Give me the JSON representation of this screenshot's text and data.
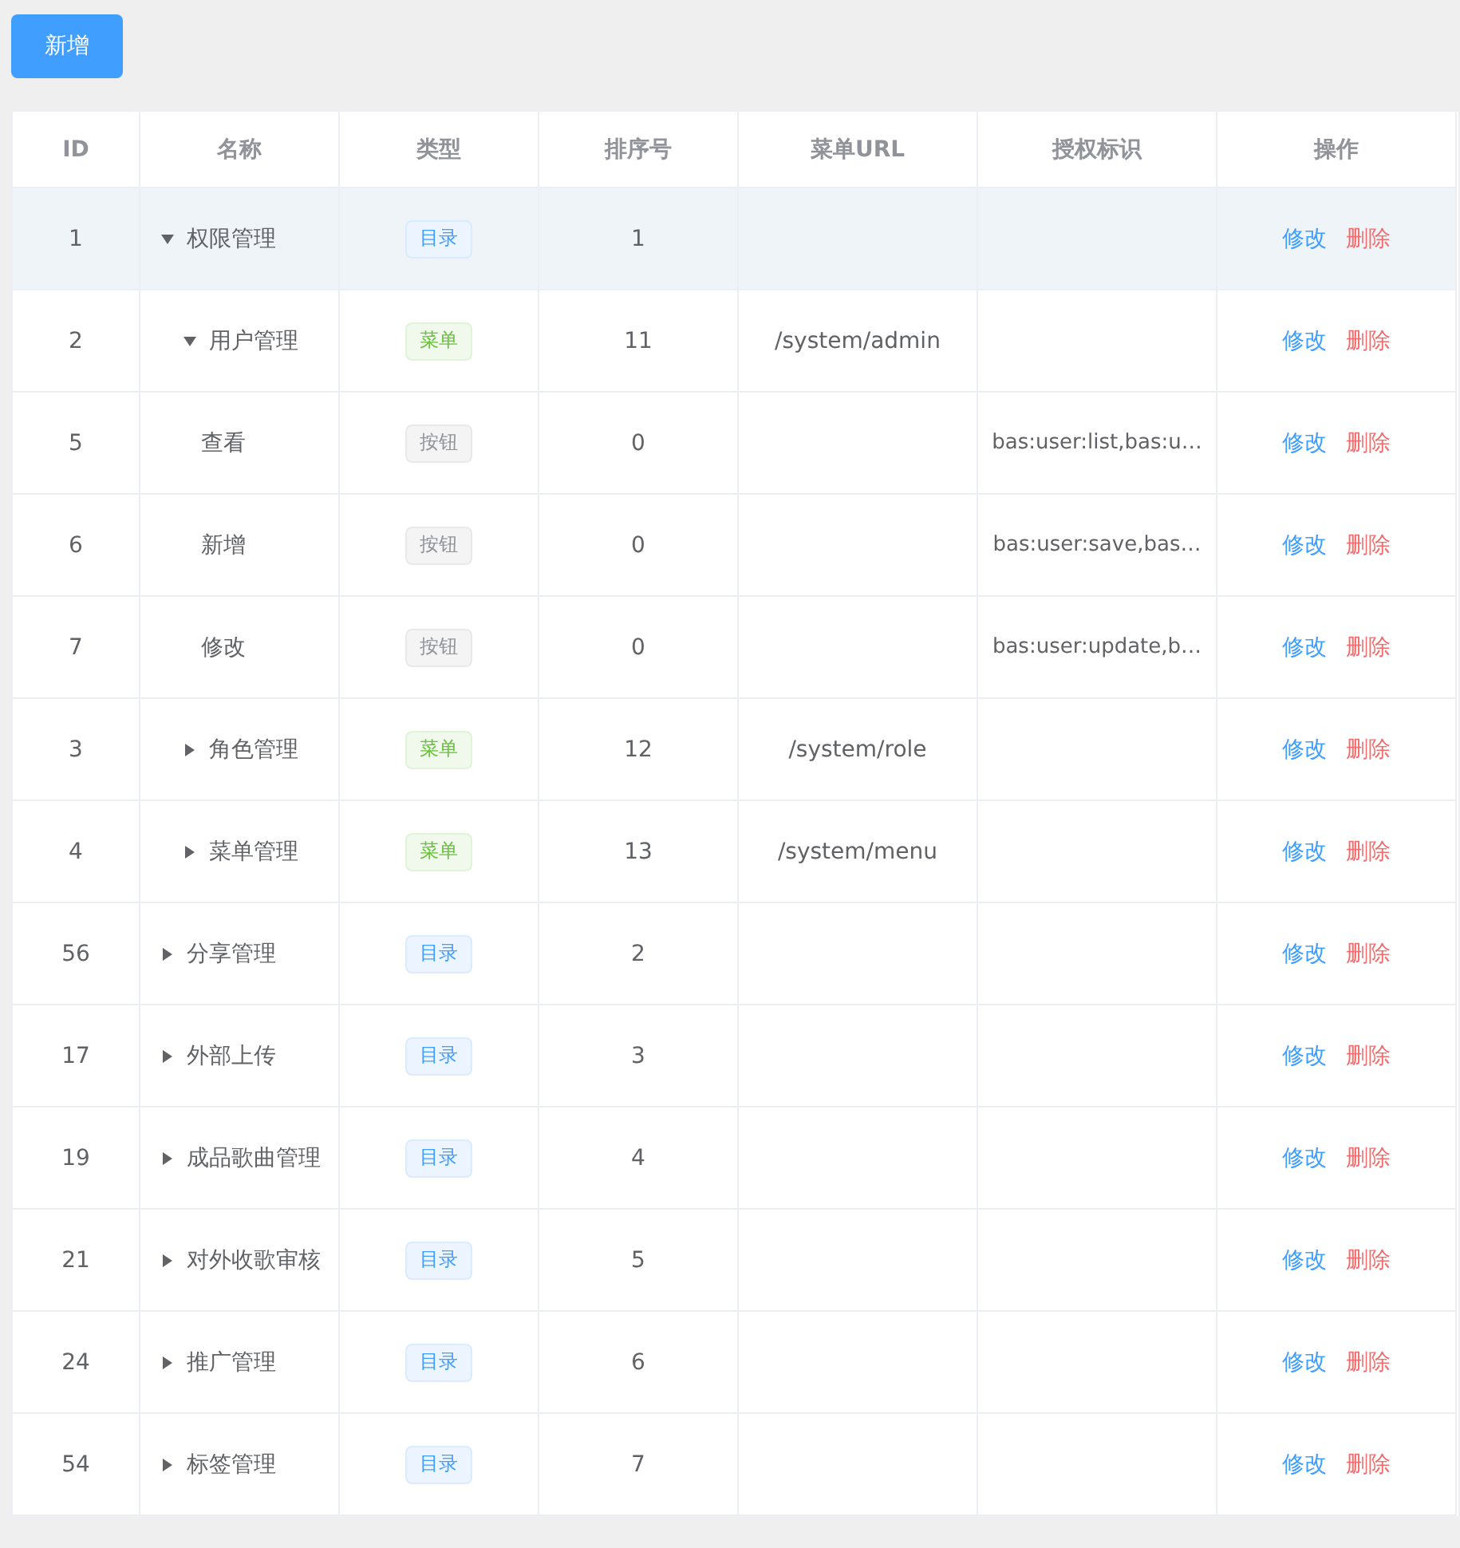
{
  "add_button": "新增",
  "table": {
    "columns": [
      "ID",
      "名称",
      "类型",
      "排序号",
      "菜单URL",
      "授权标识",
      "操作"
    ],
    "rows": [
      {
        "id": "1",
        "name": "权限管理",
        "expandable": true,
        "expanded": true,
        "selected": true,
        "type": {
          "kind": "directory",
          "label": "目录"
        },
        "order": "1",
        "actions": [
          {
            "kind": "edit",
            "label": "修改"
          },
          {
            "kind": "delete",
            "label": "删除"
          }
        ],
        "children": [
          {
            "id": "2",
            "name": "用户管理",
            "expandable": true,
            "expanded": true,
            "selected": false,
            "type": {
              "kind": "menu",
              "label": "菜单"
            },
            "order": "11",
            "url": "/system/admin",
            "actions": [
              {
                "kind": "edit",
                "label": "修改"
              },
              {
                "kind": "delete",
                "label": "删除"
              }
            ],
            "children": [
              {
                "id": "5",
                "name": "查看",
                "expandable": false,
                "selected": false,
                "type": {
                  "kind": "button",
                  "label": "按钮"
                },
                "order": "0",
                "perm": "bas:user:list,bas:u…",
                "actions": [
                  {
                    "kind": "edit",
                    "label": "修改"
                  },
                  {
                    "kind": "delete",
                    "label": "删除"
                  }
                ]
              },
              {
                "id": "6",
                "name": "新增",
                "expandable": false,
                "selected": false,
                "type": {
                  "kind": "button",
                  "label": "按钮"
                },
                "order": "0",
                "perm": "bas:user:save,bas…",
                "actions": [
                  {
                    "kind": "edit",
                    "label": "修改"
                  },
                  {
                    "kind": "delete",
                    "label": "删除"
                  }
                ]
              },
              {
                "id": "7",
                "name": "修改",
                "expandable": false,
                "selected": false,
                "type": {
                  "kind": "button",
                  "label": "按钮"
                },
                "order": "0",
                "perm": "bas:user:update,b…",
                "actions": [
                  {
                    "kind": "edit",
                    "label": "修改"
                  },
                  {
                    "kind": "delete",
                    "label": "删除"
                  }
                ]
              }
            ]
          },
          {
            "id": "3",
            "name": "角色管理",
            "expandable": true,
            "expanded": false,
            "selected": false,
            "type": {
              "kind": "menu",
              "label": "菜单"
            },
            "order": "12",
            "url": "/system/role",
            "actions": [
              {
                "kind": "edit",
                "label": "修改"
              },
              {
                "kind": "delete",
                "label": "删除"
              }
            ]
          },
          {
            "id": "4",
            "name": "菜单管理",
            "expandable": true,
            "expanded": false,
            "selected": false,
            "type": {
              "kind": "menu",
              "label": "菜单"
            },
            "order": "13",
            "url": "/system/menu",
            "actions": [
              {
                "kind": "edit",
                "label": "修改"
              },
              {
                "kind": "delete",
                "label": "删除"
              }
            ]
          }
        ]
      },
      {
        "id": "56",
        "name": "分享管理",
        "expandable": true,
        "expanded": false,
        "selected": false,
        "type": {
          "kind": "directory",
          "label": "目录"
        },
        "order": "2",
        "actions": [
          {
            "kind": "edit",
            "label": "修改"
          },
          {
            "kind": "delete",
            "label": "删除"
          }
        ]
      },
      {
        "id": "17",
        "name": "外部上传",
        "expandable": true,
        "expanded": false,
        "selected": false,
        "type": {
          "kind": "directory",
          "label": "目录"
        },
        "order": "3",
        "actions": [
          {
            "kind": "edit",
            "label": "修改"
          },
          {
            "kind": "delete",
            "label": "删除"
          }
        ]
      },
      {
        "id": "19",
        "name": "成品歌曲管理",
        "expandable": true,
        "expanded": false,
        "selected": false,
        "type": {
          "kind": "directory",
          "label": "目录"
        },
        "order": "4",
        "actions": [
          {
            "kind": "edit",
            "label": "修改"
          },
          {
            "kind": "delete",
            "label": "删除"
          }
        ]
      },
      {
        "id": "21",
        "name": "对外收歌审核",
        "expandable": true,
        "expanded": false,
        "selected": false,
        "type": {
          "kind": "directory",
          "label": "目录"
        },
        "order": "5",
        "actions": [
          {
            "kind": "edit",
            "label": "修改"
          },
          {
            "kind": "delete",
            "label": "删除"
          }
        ]
      },
      {
        "id": "24",
        "name": "推广管理",
        "expandable": true,
        "expanded": false,
        "selected": false,
        "type": {
          "kind": "directory",
          "label": "目录"
        },
        "order": "6",
        "actions": [
          {
            "kind": "edit",
            "label": "修改"
          },
          {
            "kind": "delete",
            "label": "删除"
          }
        ]
      },
      {
        "id": "54",
        "name": "标签管理",
        "expandable": true,
        "expanded": false,
        "selected": false,
        "type": {
          "kind": "directory",
          "label": "目录"
        },
        "order": "7",
        "actions": [
          {
            "kind": "edit",
            "label": "修改"
          },
          {
            "kind": "delete",
            "label": "删除"
          }
        ]
      }
    ]
  }
}
